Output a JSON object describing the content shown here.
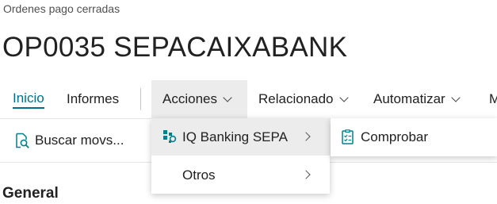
{
  "breadcrumb": "Ordenes pago cerradas",
  "title": "OP0035 SEPACAIXABANK",
  "actionbar": {
    "inicio": "Inicio",
    "informes": "Informes",
    "acciones": "Acciones",
    "relacionado": "Relacionado",
    "automatizar": "Automatizar",
    "more": "M"
  },
  "buscar_label": "Buscar movs...",
  "section_title": "General",
  "acciones_menu": {
    "items": [
      {
        "label": "IQ Banking SEPA",
        "icon": "banking-icon"
      },
      {
        "label": "Otros"
      }
    ]
  },
  "submenu": {
    "items": [
      {
        "label": "Comprobar",
        "icon": "checklist-icon"
      }
    ]
  },
  "colors": {
    "accent": "#00718a",
    "hover_bg": "#ececec",
    "icon_teal": "#00818a"
  }
}
